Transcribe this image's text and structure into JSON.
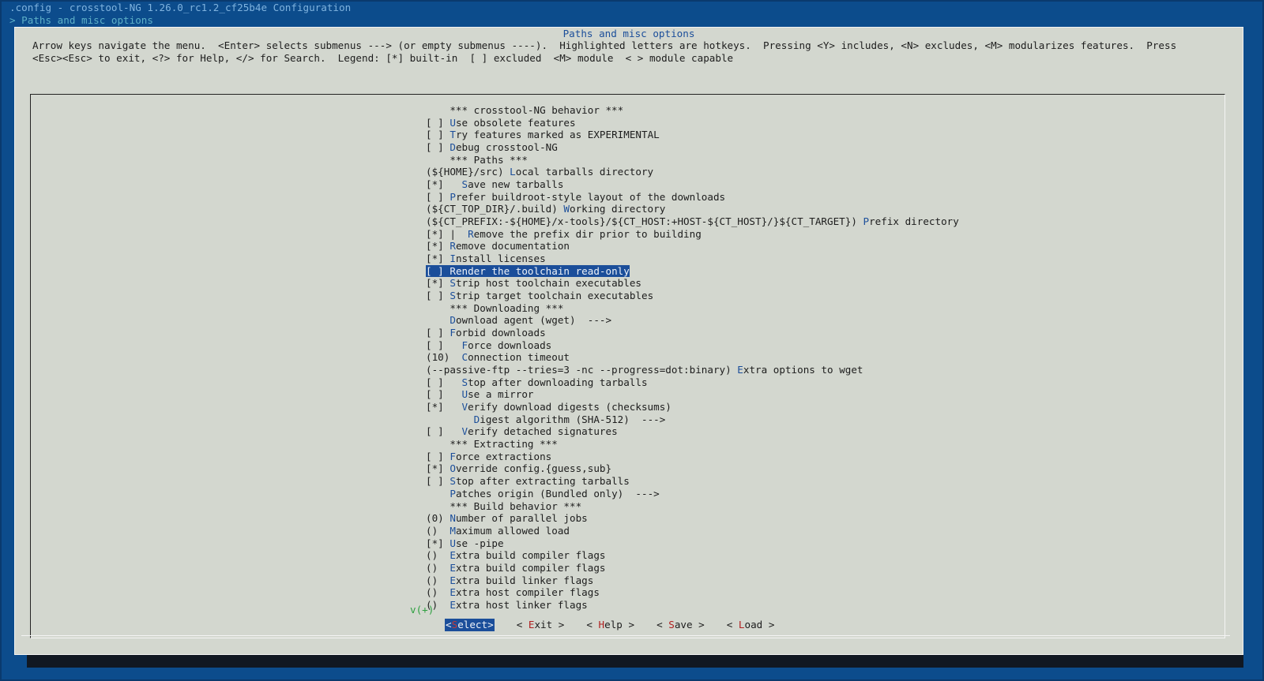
{
  "window": {
    "title": ".config - crosstool-NG 1.26.0_rc1.2_cf25b4e Configuration",
    "breadcrumb": "> Paths and misc options"
  },
  "dialog": {
    "title": "Paths and misc options",
    "help_line1": "Arrow keys navigate the menu.  <Enter> selects submenus ---> (or empty submenus ----).  Highlighted letters are hotkeys.  Pressing <Y> includes, <N> excludes, <M> modularizes features.  Press",
    "help_line2": "<Esc><Esc> to exit, <?> for Help, </> for Search.  Legend: [*] built-in  [ ] excluded  <M> module  < > module capable"
  },
  "menu": {
    "selected_index": 13,
    "more_indicator": "v(+)",
    "items": [
      {
        "prefix": "    ",
        "hotkey": "",
        "rest": "*** crosstool-NG behavior ***"
      },
      {
        "prefix": "[ ] ",
        "hotkey": "U",
        "rest": "se obsolete features"
      },
      {
        "prefix": "[ ] ",
        "hotkey": "T",
        "rest": "ry features marked as EXPERIMENTAL"
      },
      {
        "prefix": "[ ] ",
        "hotkey": "D",
        "rest": "ebug crosstool-NG"
      },
      {
        "prefix": "    ",
        "hotkey": "",
        "rest": "*** Paths ***"
      },
      {
        "prefix": "(${HOME}/src) ",
        "hotkey": "L",
        "rest": "ocal tarballs directory"
      },
      {
        "prefix": "[*]   ",
        "hotkey": "S",
        "rest": "ave new tarballs"
      },
      {
        "prefix": "[ ] ",
        "hotkey": "P",
        "rest": "refer buildroot-style layout of the downloads"
      },
      {
        "prefix": "(${CT_TOP_DIR}/.build) ",
        "hotkey": "W",
        "rest": "orking directory"
      },
      {
        "prefix": "(${CT_PREFIX:-${HOME}/x-tools}/${CT_HOST:+HOST-${CT_HOST}/}${CT_TARGET}) ",
        "hotkey": "P",
        "rest": "refix directory"
      },
      {
        "prefix": "[*] |  ",
        "hotkey": "R",
        "rest": "emove the prefix dir prior to building"
      },
      {
        "prefix": "[*] ",
        "hotkey": "R",
        "rest": "emove documentation"
      },
      {
        "prefix": "[*] ",
        "hotkey": "I",
        "rest": "nstall licenses"
      },
      {
        "prefix": "[ ] ",
        "hotkey": "R",
        "rest": "ender the toolchain read-only"
      },
      {
        "prefix": "[*] ",
        "hotkey": "S",
        "rest": "trip host toolchain executables"
      },
      {
        "prefix": "[ ] ",
        "hotkey": "S",
        "rest": "trip target toolchain executables"
      },
      {
        "prefix": "    ",
        "hotkey": "",
        "rest": "*** Downloading ***"
      },
      {
        "prefix": "    ",
        "hotkey": "D",
        "rest": "ownload agent (wget)  --->"
      },
      {
        "prefix": "[ ] ",
        "hotkey": "F",
        "rest": "orbid downloads"
      },
      {
        "prefix": "[ ]   ",
        "hotkey": "F",
        "rest": "orce downloads"
      },
      {
        "prefix": "(10)  ",
        "hotkey": "C",
        "rest": "onnection timeout"
      },
      {
        "prefix": "(--passive-ftp --tries=3 -nc --progress=dot:binary) ",
        "hotkey": "E",
        "rest": "xtra options to wget"
      },
      {
        "prefix": "[ ]   ",
        "hotkey": "S",
        "rest": "top after downloading tarballs"
      },
      {
        "prefix": "[ ]   ",
        "hotkey": "U",
        "rest": "se a mirror"
      },
      {
        "prefix": "[*]   ",
        "hotkey": "V",
        "rest": "erify download digests (checksums)"
      },
      {
        "prefix": "        ",
        "hotkey": "D",
        "rest": "igest algorithm (SHA-512)  --->"
      },
      {
        "prefix": "[ ]   ",
        "hotkey": "V",
        "rest": "erify detached signatures"
      },
      {
        "prefix": "    ",
        "hotkey": "",
        "rest": "*** Extracting ***"
      },
      {
        "prefix": "[ ] ",
        "hotkey": "F",
        "rest": "orce extractions"
      },
      {
        "prefix": "[*] ",
        "hotkey": "O",
        "rest": "verride config.{guess,sub}"
      },
      {
        "prefix": "[ ] ",
        "hotkey": "S",
        "rest": "top after extracting tarballs"
      },
      {
        "prefix": "    ",
        "hotkey": "P",
        "rest": "atches origin (Bundled only)  --->"
      },
      {
        "prefix": "    ",
        "hotkey": "",
        "rest": "*** Build behavior ***"
      },
      {
        "prefix": "(0) ",
        "hotkey": "N",
        "rest": "umber of parallel jobs"
      },
      {
        "prefix": "()  ",
        "hotkey": "M",
        "rest": "aximum allowed load"
      },
      {
        "prefix": "[*] ",
        "hotkey": "U",
        "rest": "se -pipe"
      },
      {
        "prefix": "()  ",
        "hotkey": "E",
        "rest": "xtra build compiler flags"
      },
      {
        "prefix": "()  ",
        "hotkey": "E",
        "rest": "xtra build compiler flags"
      },
      {
        "prefix": "()  ",
        "hotkey": "E",
        "rest": "xtra build linker flags"
      },
      {
        "prefix": "()  ",
        "hotkey": "E",
        "rest": "xtra host compiler flags"
      },
      {
        "prefix": "()  ",
        "hotkey": "E",
        "rest": "xtra host linker flags"
      }
    ]
  },
  "buttons": [
    {
      "name": "select-button",
      "pre": "<",
      "hotkey": "S",
      "post": "elect>",
      "active": true
    },
    {
      "name": "exit-button",
      "pre": "< ",
      "hotkey": "E",
      "post": "xit >",
      "active": false
    },
    {
      "name": "help-button",
      "pre": "< ",
      "hotkey": "H",
      "post": "elp >",
      "active": false
    },
    {
      "name": "save-button",
      "pre": "< ",
      "hotkey": "S",
      "post": "ave >",
      "active": false
    },
    {
      "name": "load-button",
      "pre": "< ",
      "hotkey": "L",
      "post": "oad >",
      "active": false
    }
  ]
}
